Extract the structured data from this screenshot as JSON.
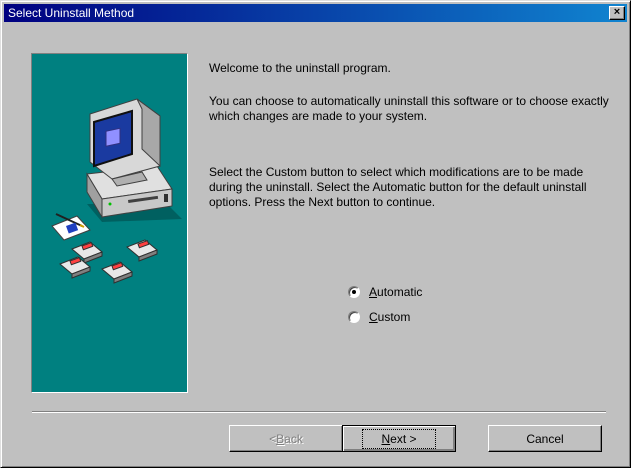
{
  "window": {
    "title": "Select Uninstall Method",
    "close_glyph": "×"
  },
  "side_panel": {
    "illustration": "computer-with-floppy-disks",
    "bg_color": "#008080"
  },
  "content": {
    "welcome": "Welcome to the  uninstall program.",
    "choose": "You can choose to automatically uninstall this software or to choose exactly which changes are made to your system.",
    "instructions": "Select the Custom button to select which modifications are to be made during the uninstall. Select the Automatic button for the default uninstall options. Press the Next button to continue."
  },
  "options": {
    "selected": "Automatic",
    "automatic": {
      "mnemonic": "A",
      "rest": "utomatic"
    },
    "custom": {
      "mnemonic": "C",
      "rest": "ustom"
    }
  },
  "buttons": {
    "back": {
      "prefix": "< ",
      "mnemonic": "B",
      "rest": "ack"
    },
    "next": {
      "mnemonic": "N",
      "rest": "ext >"
    },
    "cancel": "Cancel"
  }
}
